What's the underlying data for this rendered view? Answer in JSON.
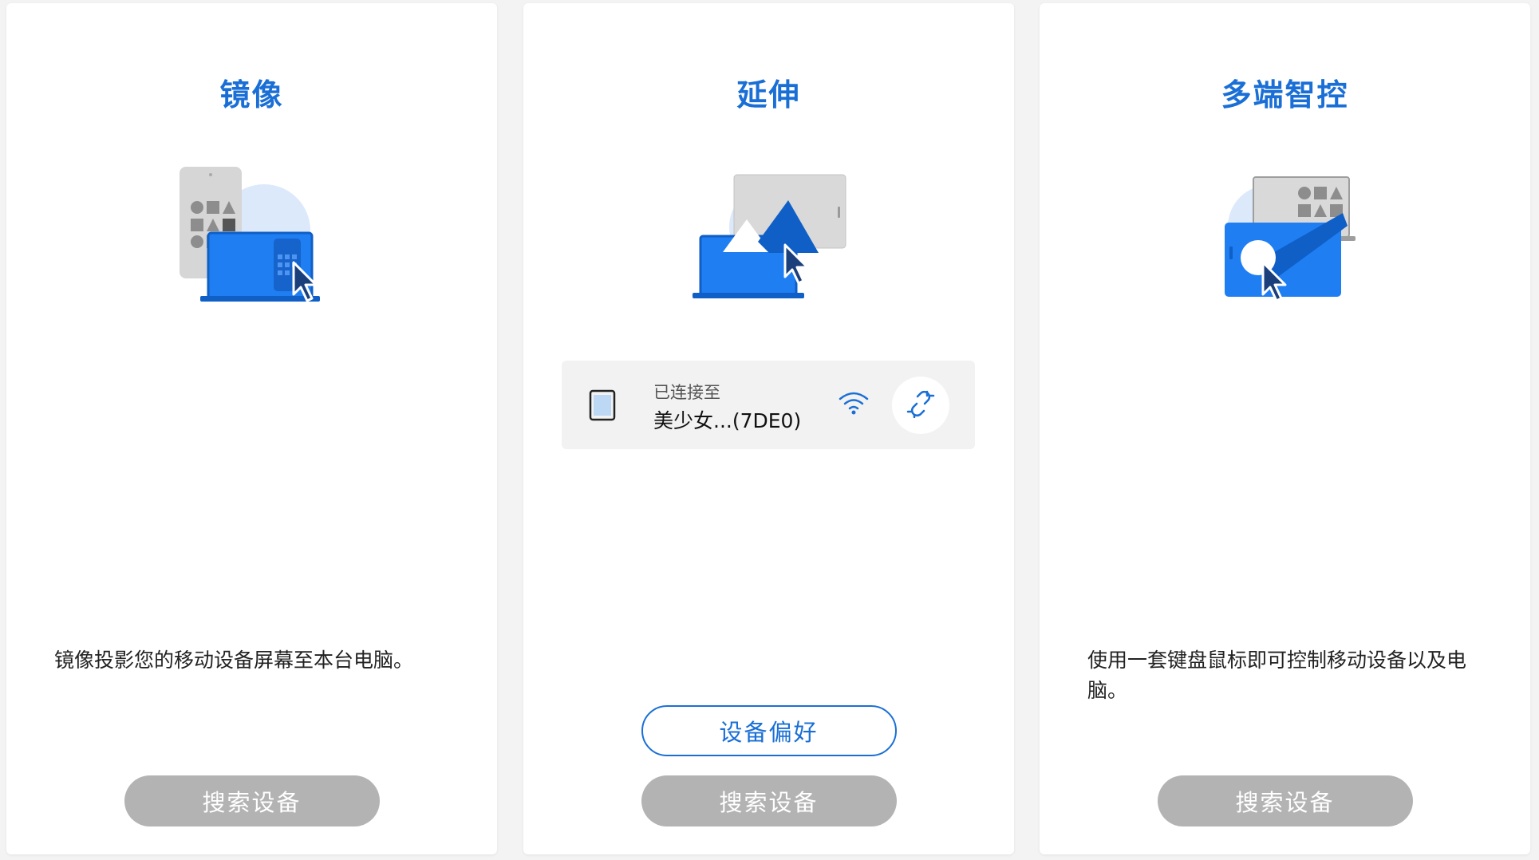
{
  "colors": {
    "accent": "#1a6fd6",
    "button_disabled": "#b3b3b3",
    "card_bg": "#ffffff",
    "page_bg": "#f3f3f3"
  },
  "cards": [
    {
      "title": "镜像",
      "description": "镜像投影您的移动设备屏幕至本台电脑。",
      "search_button": "搜索设备",
      "illustration": "phone-to-laptop-mirror-illustration"
    },
    {
      "title": "延伸",
      "connection": {
        "label": "已连接至",
        "device_name": "美少女...(7DE0)",
        "device_icon": "tablet-icon",
        "signal_icon": "wifi-icon",
        "action_icon": "unlink-icon"
      },
      "preference_button": "设备偏好",
      "search_button": "搜索设备",
      "illustration": "extend-display-illustration"
    },
    {
      "title": "多端智控",
      "description": "使用一套键盘鼠标即可控制移动设备以及电脑。",
      "search_button": "搜索设备",
      "illustration": "multi-device-control-illustration"
    }
  ]
}
